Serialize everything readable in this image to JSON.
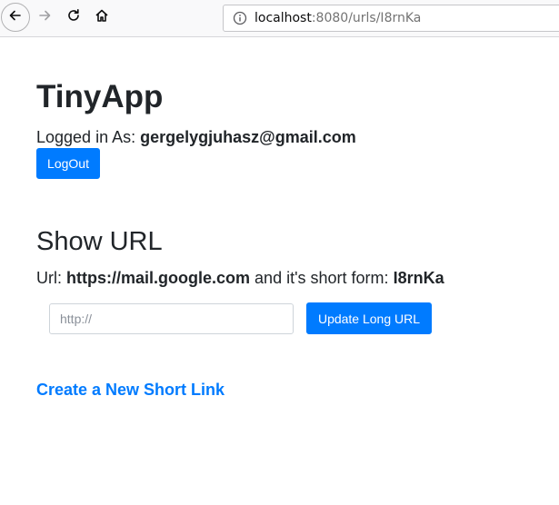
{
  "browser": {
    "url_host": "localhost",
    "url_rest": ":8080/urls/I8rnKa"
  },
  "page": {
    "app_title": "TinyApp",
    "login_prefix": "Logged in As:",
    "user_email": "gergelygjuhasz@gmail.com",
    "logout_label": "LogOut",
    "section_title": "Show URL",
    "url_prefix": "Url:",
    "long_url": "https://mail.google.com",
    "short_form_text": "and it's short form:",
    "short_code": "I8rnKa",
    "long_url_input": {
      "value": "",
      "placeholder": "http://"
    },
    "update_label": "Update Long URL",
    "create_link_label": "Create a New Short Link"
  },
  "colors": {
    "primary": "#007bff",
    "text": "#212529"
  }
}
